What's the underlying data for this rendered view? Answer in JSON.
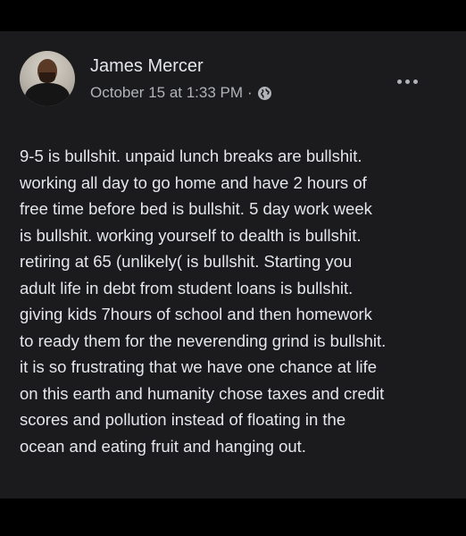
{
  "post": {
    "author": "James Mercer",
    "timestamp": "October 15 at 1:33 PM",
    "separator": "·",
    "privacy_icon": "globe-icon",
    "more_icon": "more-options-icon",
    "body_lines": [
      "9-5 is bullshit. unpaid lunch breaks are bullshit.",
      "working all day to go home and have 2 hours of",
      "free time before bed is bullshit. 5 day work week",
      "is bullshit. working yourself to dealth is bullshit.",
      "retiring at 65 (unlikely( is bullshit. Starting you",
      "adult life in debt from student loans is bullshit.",
      "giving kids 7hours of school and then homework",
      "to ready them for the neverending grind is bullshit.",
      "it is so frustrating that we have one chance at life",
      "on this earth and humanity chose taxes and credit",
      "scores and pollution instead of floating in the",
      "ocean and eating fruit and hanging out."
    ]
  },
  "colors": {
    "card_background": "#1b1b1d",
    "frame_background": "#000000",
    "primary_text": "#e4e6eb",
    "secondary_text": "#b0b3b8"
  }
}
